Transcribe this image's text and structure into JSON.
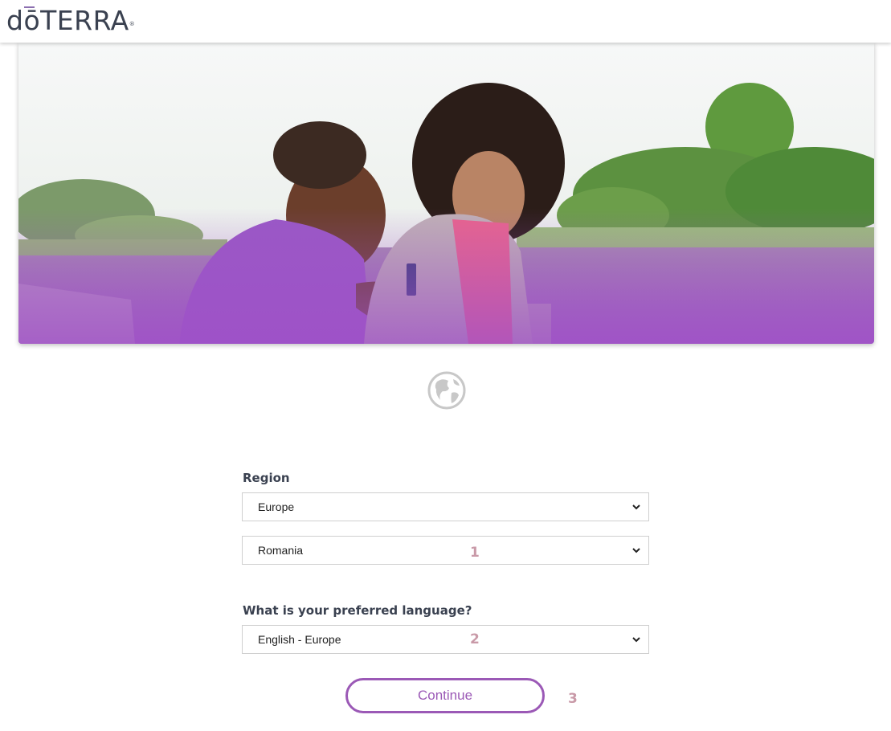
{
  "header": {
    "logo_text": "dōTERRA",
    "logo_mark": "®"
  },
  "hero": {
    "image": "couple-with-essential-oil-by-lake"
  },
  "globe": {
    "icon": "globe-icon"
  },
  "region": {
    "label": "Region",
    "region_value": "Europe",
    "country_value": "Romania"
  },
  "language": {
    "label": "What is your preferred language?",
    "value": "English - Europe"
  },
  "annotations": {
    "step1": "1",
    "step2": "2",
    "step3": "3"
  },
  "actions": {
    "continue_label": "Continue"
  },
  "colors": {
    "accent": "#9b59b6",
    "annotation": "#c99aa8",
    "text_dark": "#3a4150"
  }
}
